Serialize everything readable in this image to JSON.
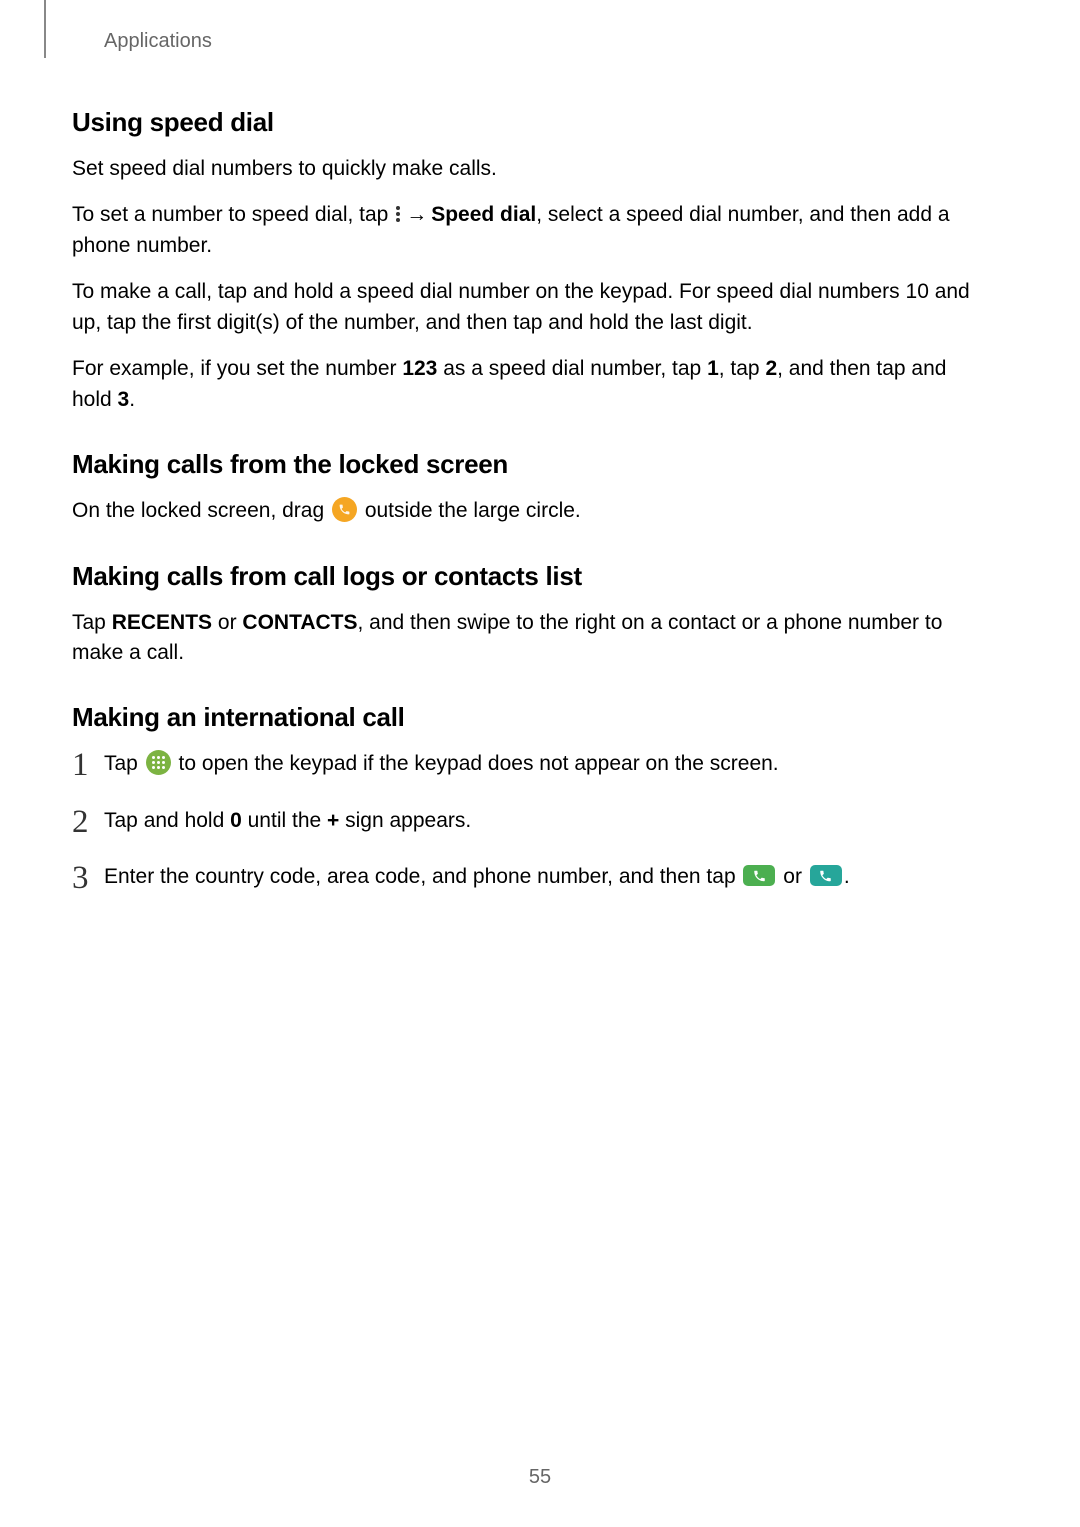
{
  "header": {
    "label": "Applications"
  },
  "section1": {
    "title": "Using speed dial",
    "p1": "Set speed dial numbers to quickly make calls.",
    "p2_a": "To set a number to speed dial, tap ",
    "p2_arrow": "→",
    "p2_speed": "Speed dial",
    "p2_b": ", select a speed dial number, and then add a phone number.",
    "p3": "To make a call, tap and hold a speed dial number on the keypad. For speed dial numbers 10 and up, tap the first digit(s) of the number, and then tap and hold the last digit.",
    "p4_a": "For example, if you set the number ",
    "p4_123": "123",
    "p4_b": " as a speed dial number, tap ",
    "p4_1": "1",
    "p4_c": ", tap ",
    "p4_2": "2",
    "p4_d": ", and then tap and hold ",
    "p4_3": "3",
    "p4_e": "."
  },
  "section2": {
    "title": "Making calls from the locked screen",
    "p1_a": "On the locked screen, drag ",
    "p1_b": " outside the large circle."
  },
  "section3": {
    "title": "Making calls from call logs or contacts list",
    "p1_a": "Tap ",
    "p1_rec": "RECENTS",
    "p1_or": " or ",
    "p1_con": "CONTACTS",
    "p1_b": ", and then swipe to the right on a contact or a phone number to make a call."
  },
  "section4": {
    "title": "Making an international call",
    "step1_a": "Tap ",
    "step1_b": " to open the keypad if the keypad does not appear on the screen.",
    "step2_a": "Tap and hold ",
    "step2_0": "0",
    "step2_b": " until the ",
    "step2_plus": "+",
    "step2_c": " sign appears.",
    "step3_a": "Enter the country code, area code, and phone number, and then tap ",
    "step3_or": " or ",
    "step3_b": "."
  },
  "page_number": "55"
}
